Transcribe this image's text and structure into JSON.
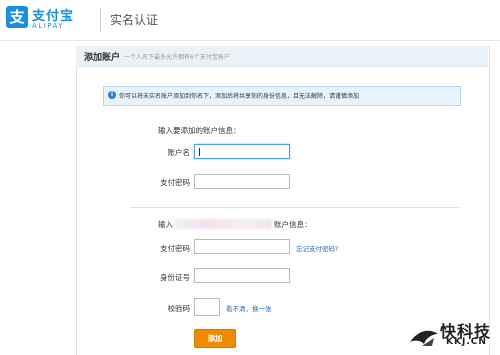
{
  "header": {
    "logo_glyph": "支",
    "logo_cn": "支付宝",
    "logo_en": "ALIPAY",
    "title": "实名认证"
  },
  "tab": {
    "title": "添加账户",
    "note": "一个人名下最多允许拥有6个支付宝账户"
  },
  "notice": {
    "icon": "i",
    "text": "你可以将未实名账户添加到你名下，添加后将共享你的身份信息，且无法解除，请谨慎添加"
  },
  "section1": {
    "heading": "输入要添加的账户信息：",
    "account_label": "账户名",
    "account_value": "",
    "password_label": "支付密码",
    "password_value": ""
  },
  "section2": {
    "heading_start": "输入",
    "heading_end": "账户信息：",
    "password_label": "支付密码",
    "password_value": "",
    "forgot_link": "忘记支付密码?",
    "id_label": "身份证号",
    "id_value": "",
    "captcha_label": "校验码",
    "captcha_value": "",
    "captcha_link": "看不清，换一张"
  },
  "submit_label": "添加",
  "watermark": {
    "cn": "快科技",
    "en": "KKJ.CN"
  },
  "colors": {
    "brand": "#1a8fe0",
    "submit": "#f08a00",
    "link": "#2a67b3"
  }
}
